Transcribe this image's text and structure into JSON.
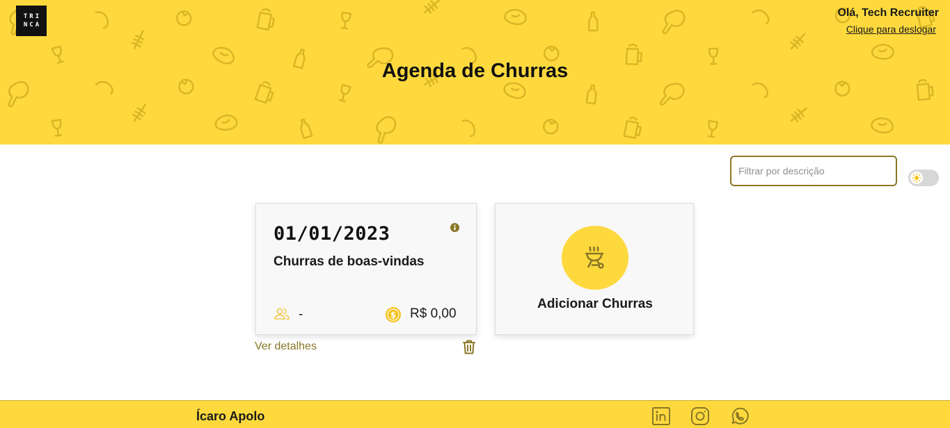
{
  "header": {
    "logo_lines": [
      "TRI",
      "NCA"
    ],
    "greeting": "Olá, Tech Recruiter",
    "logout": "Clique para deslogar",
    "title": "Agenda de Churras",
    "background_color": "#fed93e"
  },
  "filter": {
    "placeholder": "Filtrar por descrição",
    "value": ""
  },
  "theme_toggle": {
    "icon": "sun-icon",
    "state": "light"
  },
  "events": [
    {
      "date": "01/01/2023",
      "name": "Churras de boas-vindas",
      "participants": "-",
      "total": "R$ 0,00",
      "details_link": "Ver detalhes"
    }
  ],
  "add_card": {
    "label": "Adicionar Churras",
    "icon": "grill-icon"
  },
  "footer": {
    "name": "Ícaro Apolo",
    "social": [
      "linkedin-icon",
      "instagram-icon",
      "whatsapp-icon"
    ]
  },
  "colors": {
    "accent": "#fed93e",
    "link": "#8a7726",
    "pattern": "#d9b624"
  }
}
